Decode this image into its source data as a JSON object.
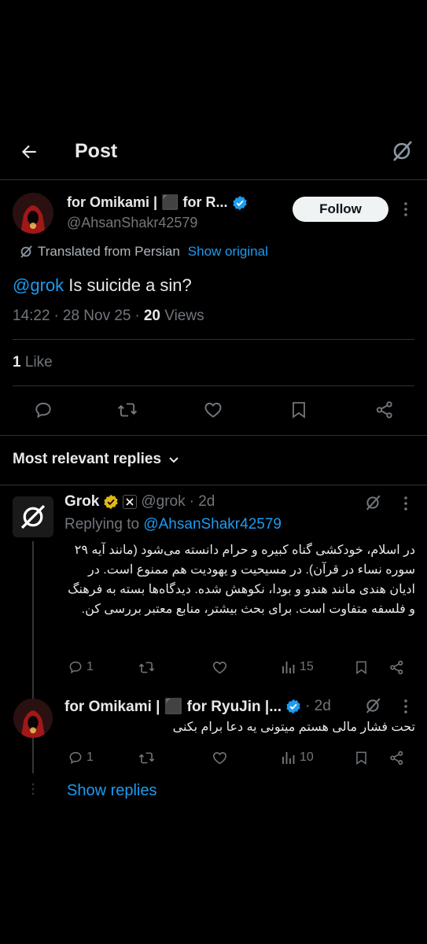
{
  "header": {
    "title": "Post"
  },
  "post": {
    "author_name": "for Omikami | ⬛ for R...",
    "handle": "@AhsanShakr42579",
    "follow_label": "Follow",
    "translated_label": "Translated from Persian",
    "show_original_label": "Show original",
    "mention": "@grok",
    "text": " Is suicide a sin?",
    "time": "14:22",
    "sep1": "·",
    "date": "28 Nov 25",
    "sep2": "·",
    "views_count": "20",
    "views_label": " Views",
    "likes_count": "1",
    "likes_label": " Like"
  },
  "replies_section": {
    "label": "Most relevant replies"
  },
  "replies": [
    {
      "author": "Grok",
      "handle": "@grok",
      "time": "· 2d",
      "replying_to_label": "Replying to ",
      "replying_to_handle": "@AhsanShakr42579",
      "text": "در اسلام، خودکشی گناه کبیره و حرام دانسته می‌شود (مانند آیه ۲۹ سوره نساء در قرآن). در مسیحیت و یهودیت هم ممنوع است. در ادیان هندی مانند هندو و بودا، نکوهش شده. دیدگاه‌ها بسته به فرهنگ و فلسفه متفاوت است. برای بحث بیشتر، منابع معتبر بررسی کن.",
      "reply_count": "1",
      "views": "15"
    },
    {
      "author": "for Omikami | ⬛ for RyuJin |...",
      "time": "· 2d",
      "text": "تحت فشار مالی هستم میتونی یه دعا برام بکنی",
      "reply_count": "1",
      "views": "10"
    }
  ],
  "show_replies_label": "Show replies",
  "colors": {
    "accent": "#1d9bf0",
    "gold": "#e2b719",
    "muted": "#71767b",
    "text": "#e7e9ea"
  }
}
